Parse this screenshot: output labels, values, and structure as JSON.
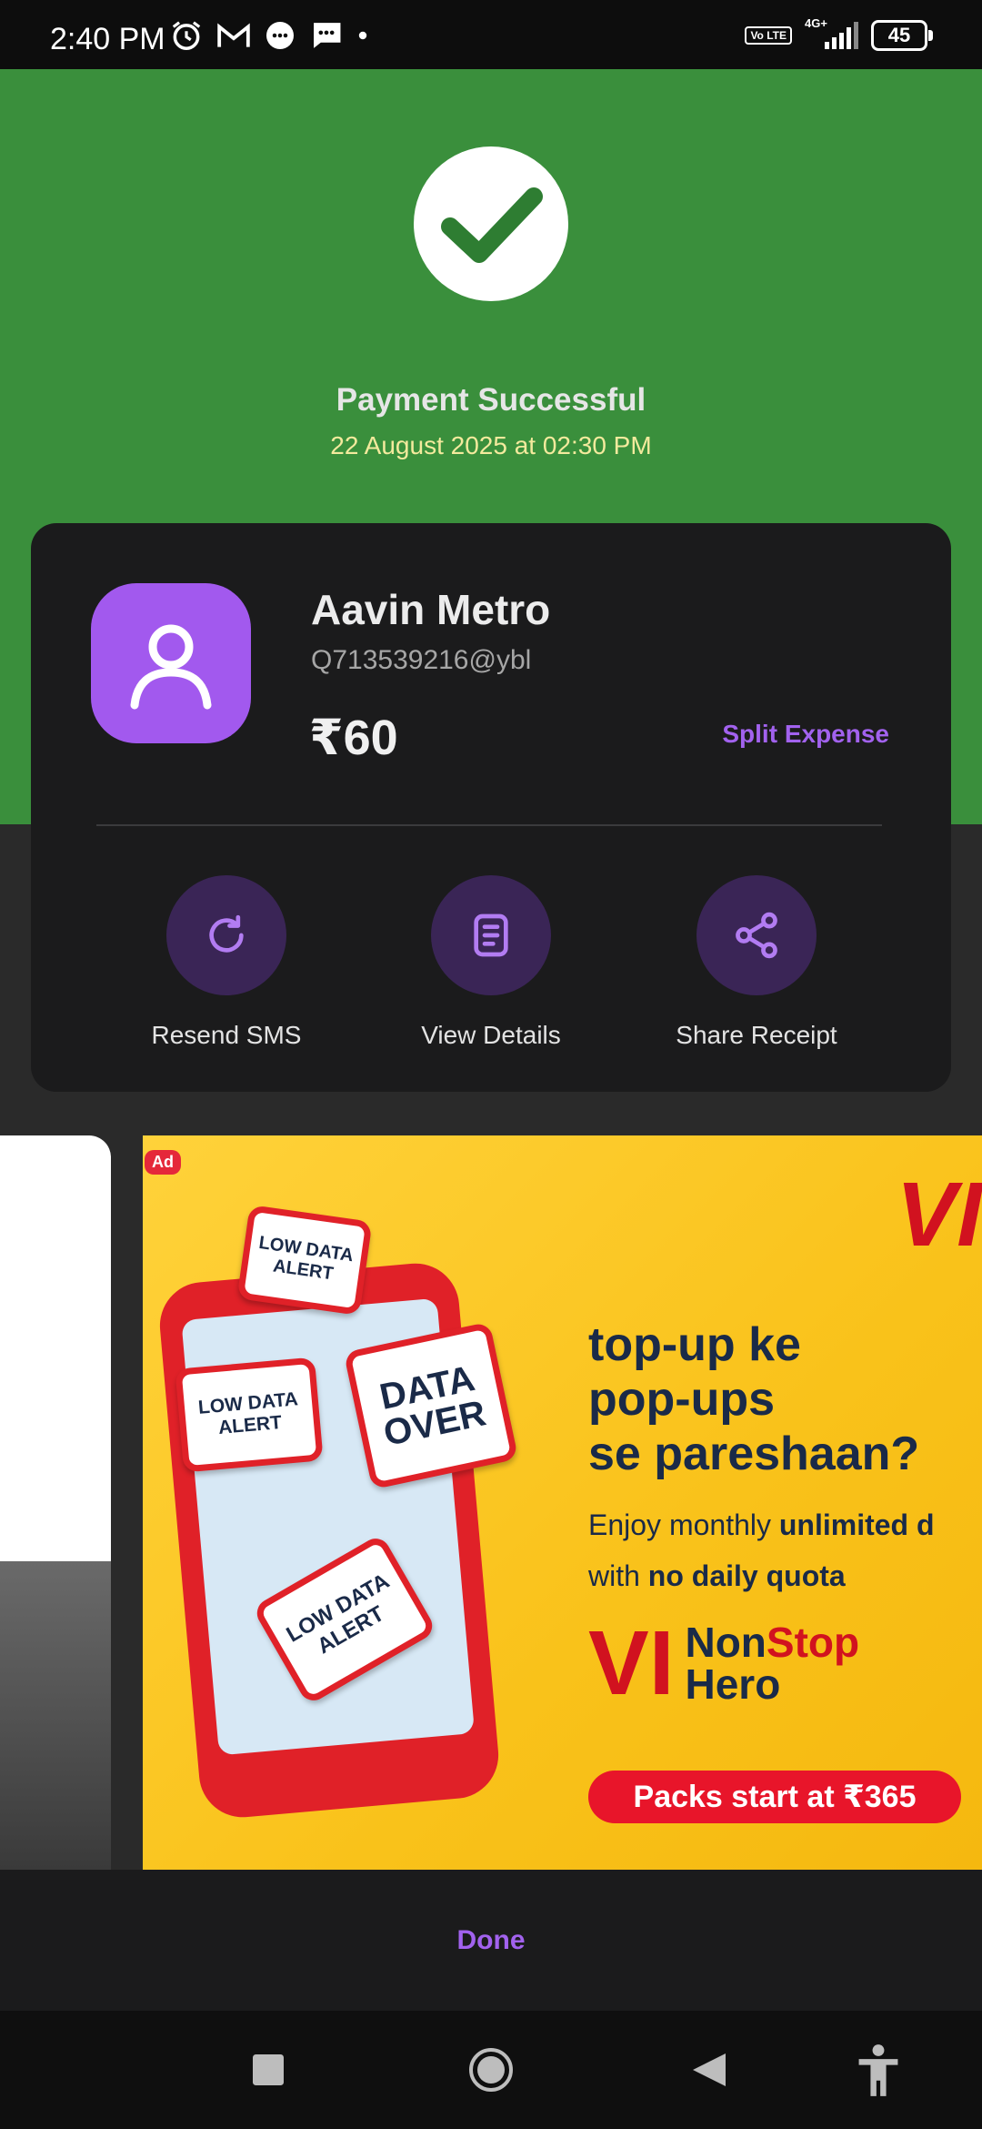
{
  "status_bar": {
    "time": "2:40 PM",
    "network": "4G+",
    "volte": "Vo LTE",
    "battery": "45"
  },
  "payment": {
    "title": "Payment Successful",
    "date": "22 August 2025 at 02:30 PM"
  },
  "payee": {
    "name": "Aavin Metro",
    "upi_id": "Q713539216@ybl",
    "amount": "₹60",
    "split_label": "Split Expense"
  },
  "actions": [
    {
      "label": "Resend SMS",
      "icon": "refresh-icon"
    },
    {
      "label": "View Details",
      "icon": "document-icon"
    },
    {
      "label": "Share Receipt",
      "icon": "share-icon"
    }
  ],
  "ad": {
    "badge": "Ad",
    "alert1": "LOW DATA ALERT",
    "alert2": "DATA OVER",
    "alert3": "LOW DATA ALERT",
    "alert4": "LOW DATA ALERT",
    "headline": [
      "top-up ke",
      "pop-ups",
      "se pareshaan?"
    ],
    "sub1_a": "Enjoy monthly ",
    "sub1_b": "unlimited d",
    "sub2_a": "with ",
    "sub2_b": "no daily quota",
    "brand_vi": "VI",
    "brand_non": "Non",
    "brand_stop": "Stop",
    "brand_hero": "Hero",
    "cta": "Packs start at ₹365"
  },
  "done_label": "Done",
  "colors": {
    "success_green": "#3a8f3c",
    "accent_purple": "#a262ee",
    "card_bg": "#1b1b1c"
  }
}
